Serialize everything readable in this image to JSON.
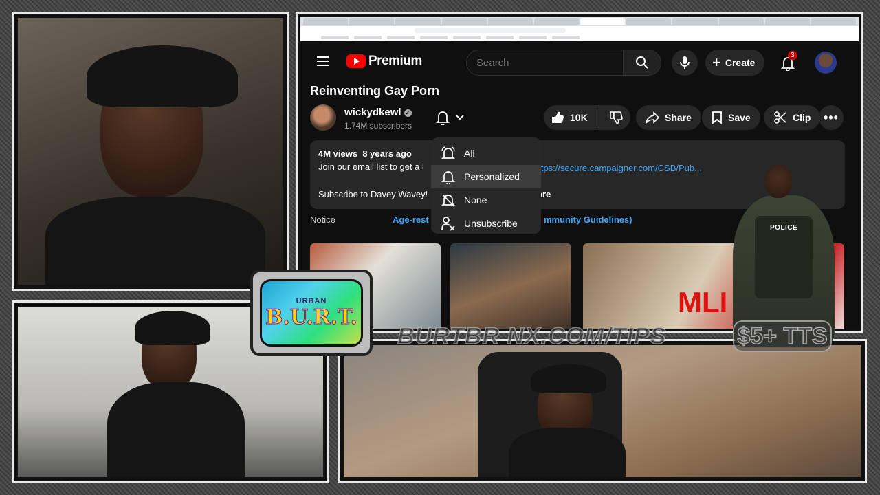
{
  "youtube": {
    "logo_text": "Premium",
    "search_placeholder": "Search",
    "create_label": "Create",
    "notification_count": "3",
    "video_title": "Reinventing Gay Porn",
    "channel_name": "wickydkewl",
    "subscribers": "1.74M subscribers",
    "likes": "10K",
    "share_label": "Share",
    "save_label": "Save",
    "clip_label": "Clip",
    "views": "4M views",
    "age": "8 years ago",
    "desc_line1": "Join our email list to get a l",
    "desc_link": "https://secure.campaigner.com/CSB/Pub...",
    "desc_line2": "Subscribe to Davey Wavey!",
    "desc_more": "ore",
    "notice_label": "Notice",
    "notice_age": "Age-rest",
    "notice_guidelines": "mmunity Guidelines)",
    "thumb3_text": "MLI",
    "notification_menu": [
      {
        "label": "All",
        "icon": "bell-ring-icon"
      },
      {
        "label": "Personalized",
        "icon": "bell-icon"
      },
      {
        "label": "None",
        "icon": "bell-off-icon"
      },
      {
        "label": "Unsubscribe",
        "icon": "person-remove-icon"
      }
    ]
  },
  "overlay": {
    "officer_label": "POLICE",
    "burt_top": "URBAN",
    "burt_main": "B.U.R.T.",
    "tips_text": "BURTBR   NX.COM/TIPS",
    "tts_text": "$5+ TTS"
  },
  "colors": {
    "yt_red": "#ff0000",
    "link_blue": "#3ea6ff",
    "badge_red": "#cc0000"
  }
}
